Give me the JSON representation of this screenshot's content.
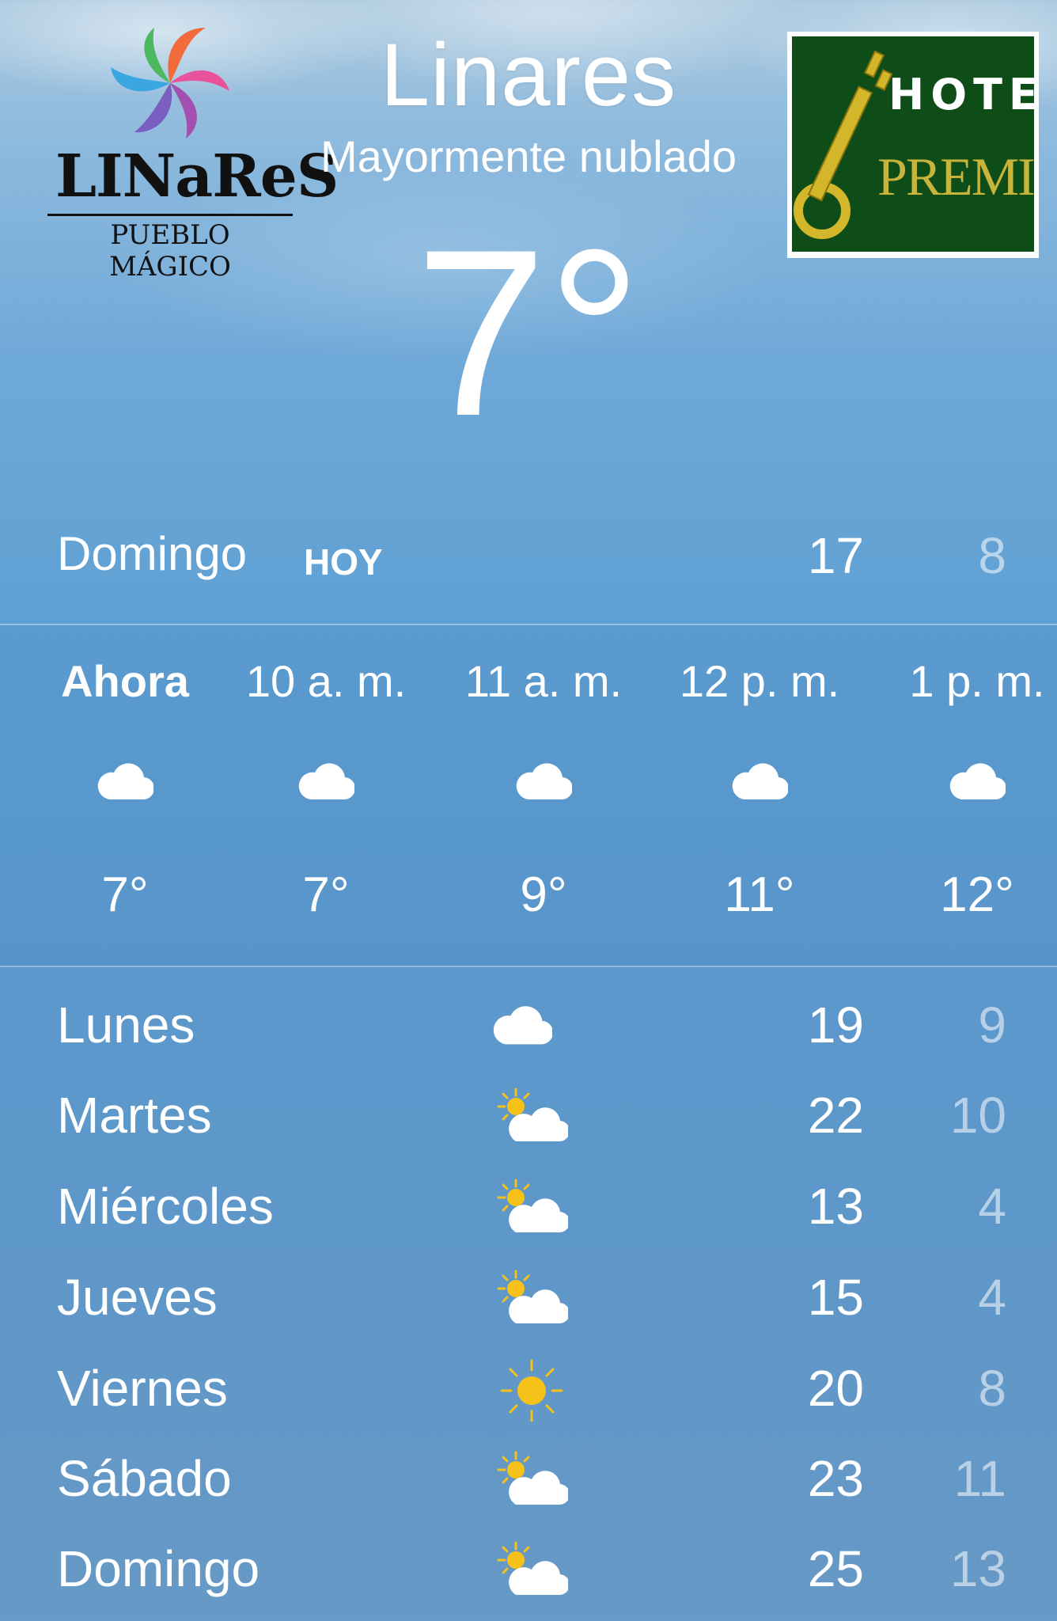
{
  "header": {
    "city": "Linares",
    "condition": "Mayormente nublado",
    "temperature": "7°"
  },
  "logos": {
    "left": {
      "line1": "LINaReS",
      "line2": "PUEBLO MÁGICO"
    },
    "right": {
      "line1": "HOTEL",
      "line2": "PREMIER"
    }
  },
  "today": {
    "day": "Domingo",
    "tag": "HOY",
    "high": "17",
    "low": "8"
  },
  "hourly": [
    {
      "time": "Ahora",
      "icon": "cloud-icon",
      "temp": "7°"
    },
    {
      "time": "10 a. m.",
      "icon": "cloud-icon",
      "temp": "7°"
    },
    {
      "time": "11 a. m.",
      "icon": "cloud-icon",
      "temp": "9°"
    },
    {
      "time": "12 p. m.",
      "icon": "cloud-icon",
      "temp": "11°"
    },
    {
      "time": "1 p. m.",
      "icon": "cloud-icon",
      "temp": "12°"
    }
  ],
  "daily": [
    {
      "day": "Lunes",
      "icon": "cloud-icon",
      "high": "19",
      "low": "9"
    },
    {
      "day": "Martes",
      "icon": "partly-sunny-icon",
      "high": "22",
      "low": "10"
    },
    {
      "day": "Miércoles",
      "icon": "partly-sunny-icon",
      "high": "13",
      "low": "4"
    },
    {
      "day": "Jueves",
      "icon": "partly-sunny-icon",
      "high": "15",
      "low": "4"
    },
    {
      "day": "Viernes",
      "icon": "sun-icon",
      "high": "20",
      "low": "8"
    },
    {
      "day": "Sábado",
      "icon": "partly-sunny-icon",
      "high": "23",
      "low": "11"
    },
    {
      "day": "Domingo",
      "icon": "partly-sunny-icon",
      "high": "25",
      "low": "13"
    }
  ],
  "colors": {
    "text": "#ffffff",
    "low_text": "rgba(255,255,255,0.55)",
    "sun": "#f6c21a",
    "sky": "#5e9fd2"
  }
}
